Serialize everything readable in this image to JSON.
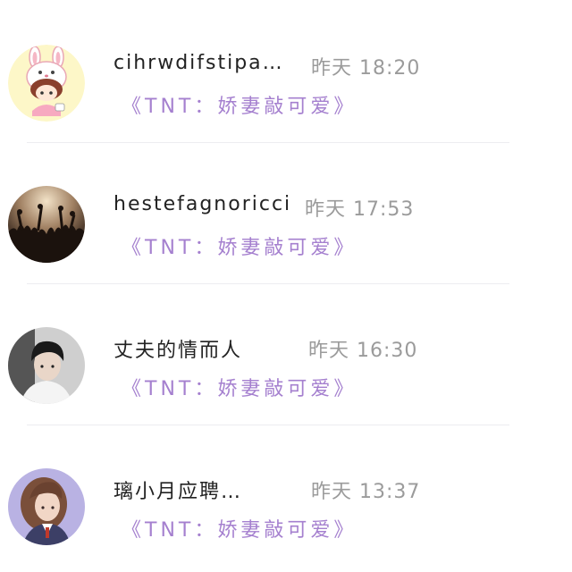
{
  "conversations": [
    {
      "name": "cihrwdifstipa…",
      "time": "昨天 18:20",
      "message": "《TNT：娇妻敲可爱》",
      "avatar": "cartoon-bunny-avatar"
    },
    {
      "name": "hestefagnoricci",
      "time": "昨天 17:53",
      "message": "《TNT：娇妻敲可爱》",
      "avatar": "concert-crowd-avatar"
    },
    {
      "name": "丈夫的情而人",
      "time": "昨天 16:30",
      "message": "《TNT：娇妻敲可爱》",
      "avatar": "boy-portrait-avatar"
    },
    {
      "name": "璃小月应聘…",
      "time": "昨天 13:37",
      "message": "《TNT：娇妻敲可爱》",
      "avatar": "illustrated-girl-avatar"
    }
  ],
  "colors": {
    "name": "#222222",
    "time": "#9b9b9b",
    "message": "#a580cf",
    "divider": "#ededf0"
  }
}
